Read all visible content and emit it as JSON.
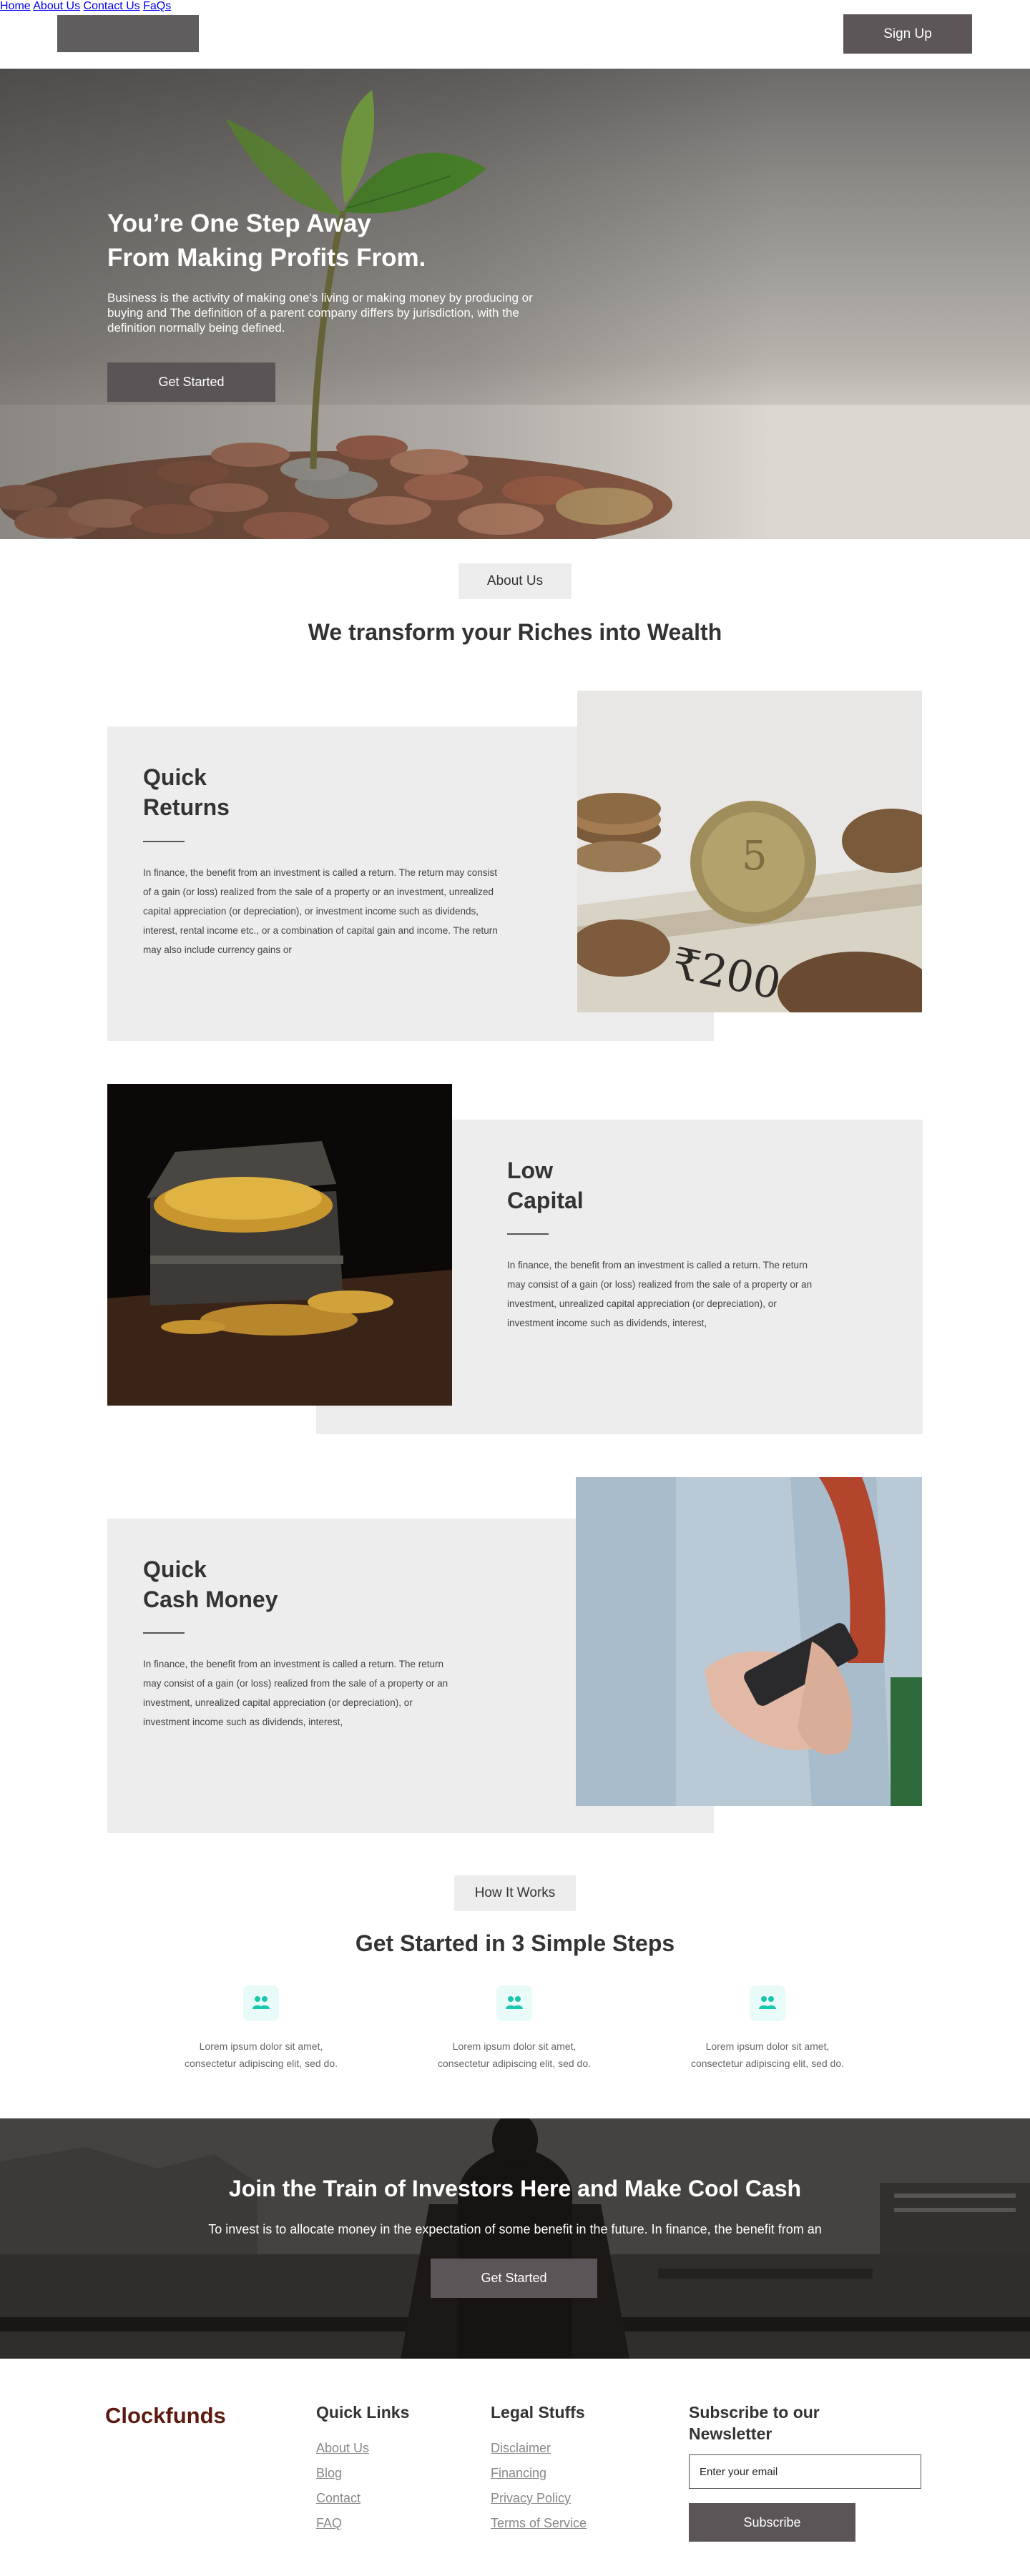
{
  "header": {
    "nav": [
      "Home",
      "About Us",
      "Contact Us",
      "FaQs"
    ],
    "signup_label": "Sign Up"
  },
  "hero": {
    "title_line1": "You’re One Step Away",
    "title_line2": "From Making Profits From.",
    "text": "Business is the activity of making one's living or making money by producing or buying and The definition of a parent company differs by jurisdiction, with the definition normally being defined.",
    "button_label": "Get Started"
  },
  "about": {
    "pill": "About Us",
    "title": "We transform your Riches into Wealth"
  },
  "features": [
    {
      "title_line1": "Quick",
      "title_line2": "Returns",
      "text": "In finance, the benefit from an investment is called a return. The return may consist of a gain (or loss) realized from the sale of a property or an investment, unrealized capital appreciation (or depreciation), or investment income such as dividends, interest, rental income etc., or a combination of capital gain and income. The return may also include currency gains or"
    },
    {
      "title_line1": "Low",
      "title_line2": "Capital",
      "text": "In finance, the benefit from an investment is called a return. The return may consist of a gain (or loss) realized from the sale of a property or an investment, unrealized capital appreciation (or depreciation), or investment income such as dividends, interest,"
    },
    {
      "title_line1": "Quick",
      "title_line2": "Cash Money",
      "text": "In finance, the benefit from an investment is called a return. The return may consist of a gain (or loss) realized from the sale of a property or an investment, unrealized capital appreciation (or depreciation), or investment income such as dividends, interest,"
    }
  ],
  "how": {
    "pill": "How It Works",
    "title": "Get Started in 3 Simple Steps",
    "steps": [
      {
        "line1": "Lorem ipsum dolor sit amet,",
        "line2": "consectetur adipiscing elit, sed do."
      },
      {
        "line1": "Lorem ipsum dolor sit amet,",
        "line2": "consectetur adipiscing elit, sed do."
      },
      {
        "line1": "Lorem ipsum dolor sit amet,",
        "line2": "consectetur adipiscing elit, sed do."
      }
    ],
    "icon": "people-group-icon",
    "icon_color": "#19c7b0"
  },
  "cta": {
    "title": "Join the Train of Investors Here and Make Cool Cash",
    "text": "To invest is to allocate money in the expectation of some benefit in the future. In finance, the benefit from an",
    "button_label": "Get Started"
  },
  "footer": {
    "brand": "Clockfunds",
    "brand_color": "#5c1a10",
    "quick_links_title": "Quick Links",
    "quick_links": [
      "About Us",
      "Blog",
      "Contact",
      "FAQ"
    ],
    "legal_title": "Legal Stuffs",
    "legal_links": [
      "Disclaimer",
      "Financing",
      "Privacy Policy",
      "Terms of Service"
    ],
    "newsletter_title_line1": "Subscribe to our",
    "newsletter_title_line2": "Newsletter",
    "email_placeholder": "Enter your email",
    "subscribe_label": "Subscribe"
  }
}
